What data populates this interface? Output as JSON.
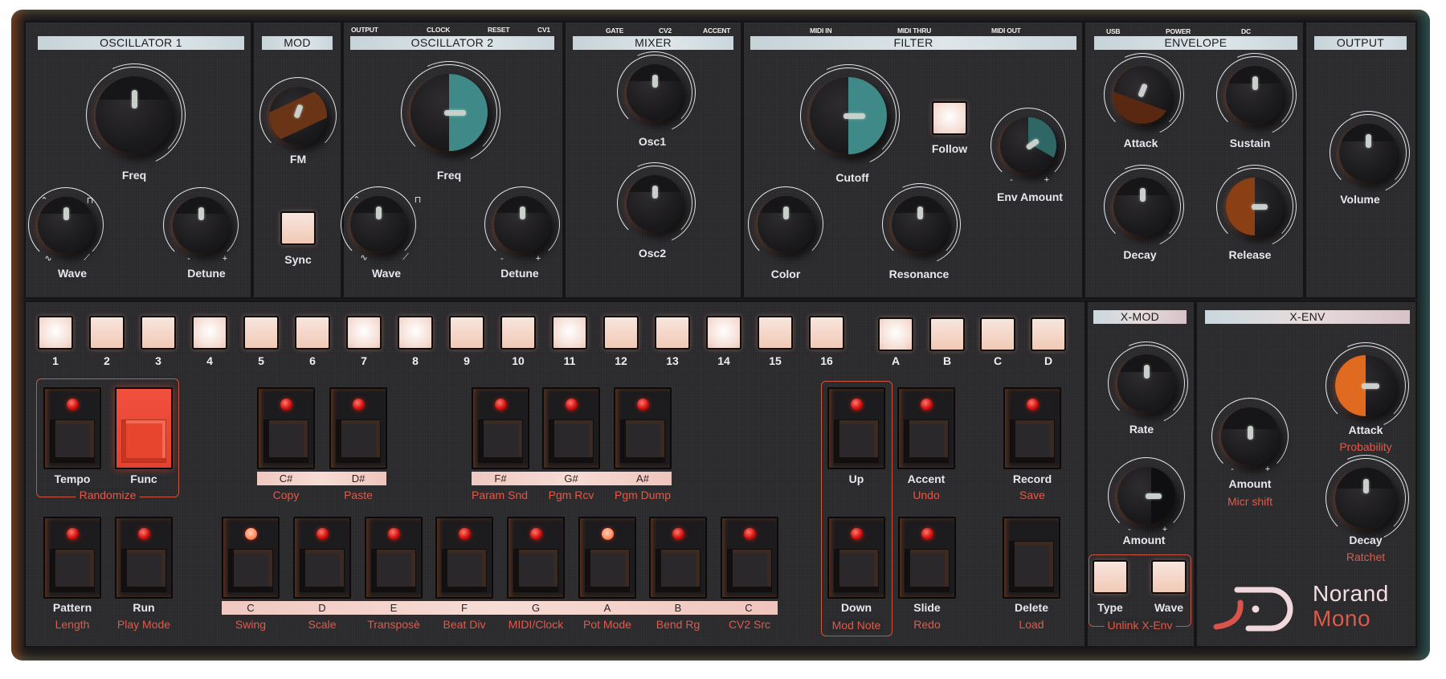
{
  "device": {
    "brand": "Norand",
    "model": "Mono"
  },
  "colors": {
    "panel": "#2a292c",
    "header_strip": "#d3dfe4",
    "accent_red": "#e05a4a",
    "func_button": "#ef4a38",
    "teal_knob": "#3f8a88",
    "orange_knob": "#e06a20",
    "pad_lit": "#f6d8cc"
  },
  "top_sections": {
    "osc1": {
      "title": "OSCILLATOR 1",
      "freq": "Freq",
      "wave": "Wave",
      "detune": "Detune",
      "minus": "-",
      "plus": "+"
    },
    "mod": {
      "title": "MOD",
      "fm": "FM",
      "sync": "Sync"
    },
    "osc2": {
      "title": "OSCILLATOR 2",
      "jacks": [
        "OUTPUT",
        "CLOCK",
        "RESET",
        "CV1"
      ],
      "freq": "Freq",
      "wave": "Wave",
      "detune": "Detune",
      "minus": "-",
      "plus": "+"
    },
    "mixer": {
      "title": "MIXER",
      "jacks": [
        "GATE",
        "CV2",
        "ACCENT"
      ],
      "osc1": "Osc1",
      "osc2": "Osc2"
    },
    "filter": {
      "title": "FILTER",
      "jacks": [
        "MIDI IN",
        "MIDI THRU",
        "MIDI OUT"
      ],
      "cutoff": "Cutoff",
      "follow": "Follow",
      "env_amount": "Env Amount",
      "color": "Color",
      "resonance": "Resonance",
      "minus": "-",
      "plus": "+"
    },
    "envelope": {
      "title": "ENVELOPE",
      "jacks": [
        "USB",
        "POWER",
        "DC"
      ],
      "attack": "Attack",
      "sustain": "Sustain",
      "decay": "Decay",
      "release": "Release"
    },
    "output": {
      "title": "OUTPUT",
      "volume": "Volume"
    }
  },
  "steps": {
    "numbers": [
      "1",
      "2",
      "3",
      "4",
      "5",
      "6",
      "7",
      "8",
      "9",
      "10",
      "11",
      "12",
      "13",
      "14",
      "15",
      "16"
    ],
    "bright": [
      1,
      4,
      7,
      8,
      11,
      14
    ],
    "pages": [
      "A",
      "B",
      "C",
      "D"
    ]
  },
  "sequencer": {
    "row1": [
      {
        "label": "Tempo",
        "alt": ""
      },
      {
        "label": "Func",
        "alt": ""
      },
      {
        "label": "",
        "alt": "Copy",
        "note": "C#"
      },
      {
        "label": "",
        "alt": "Paste",
        "note": "D#"
      },
      {
        "label": "",
        "alt": "Param Snd",
        "note": "F#"
      },
      {
        "label": "",
        "alt": "Pgm Rcv",
        "note": "G#"
      },
      {
        "label": "",
        "alt": "Pgm Dump",
        "note": "A#"
      },
      {
        "label": "Up",
        "alt": ""
      },
      {
        "label": "Accent",
        "alt": "Undo"
      },
      {
        "label": "Record",
        "alt": "Save"
      }
    ],
    "randomize": "Randomize",
    "row2": [
      {
        "label": "Pattern",
        "alt": "Length"
      },
      {
        "label": "Run",
        "alt": "Play Mode"
      },
      {
        "label": "",
        "alt": "Swing",
        "note": "C"
      },
      {
        "label": "",
        "alt": "Scale",
        "note": "D"
      },
      {
        "label": "",
        "alt": "Transposè",
        "note": "E"
      },
      {
        "label": "",
        "alt": "Beat Div",
        "note": "F"
      },
      {
        "label": "",
        "alt": "MIDI/Clock",
        "note": "G"
      },
      {
        "label": "",
        "alt": "Pot Mode",
        "note": "A"
      },
      {
        "label": "",
        "alt": "Bend Rg",
        "note": "B"
      },
      {
        "label": "",
        "alt": "CV2 Src",
        "note": "C"
      },
      {
        "label": "Down",
        "alt": ""
      },
      {
        "label": "Slide",
        "alt": "Redo"
      },
      {
        "label": "Delete",
        "alt": "Load"
      }
    ],
    "mod_note": "Mod Note"
  },
  "xmod": {
    "title": "X-MOD",
    "rate": "Rate",
    "amount": "Amount",
    "minus": "-",
    "plus": "+",
    "type": "Type",
    "wave": "Wave",
    "unlink": "Unlink X-Env"
  },
  "xenv": {
    "title": "X-ENV",
    "amount": "Amount",
    "amount_alt": "Micr shift",
    "attack": "Attack",
    "attack_alt": "Probability",
    "decay": "Decay",
    "decay_alt": "Ratchet",
    "minus": "-",
    "plus": "+"
  },
  "wave_symbols": {
    "tri": "⌃",
    "square": "⊓",
    "sine": "∿",
    "saw": "⟋"
  }
}
